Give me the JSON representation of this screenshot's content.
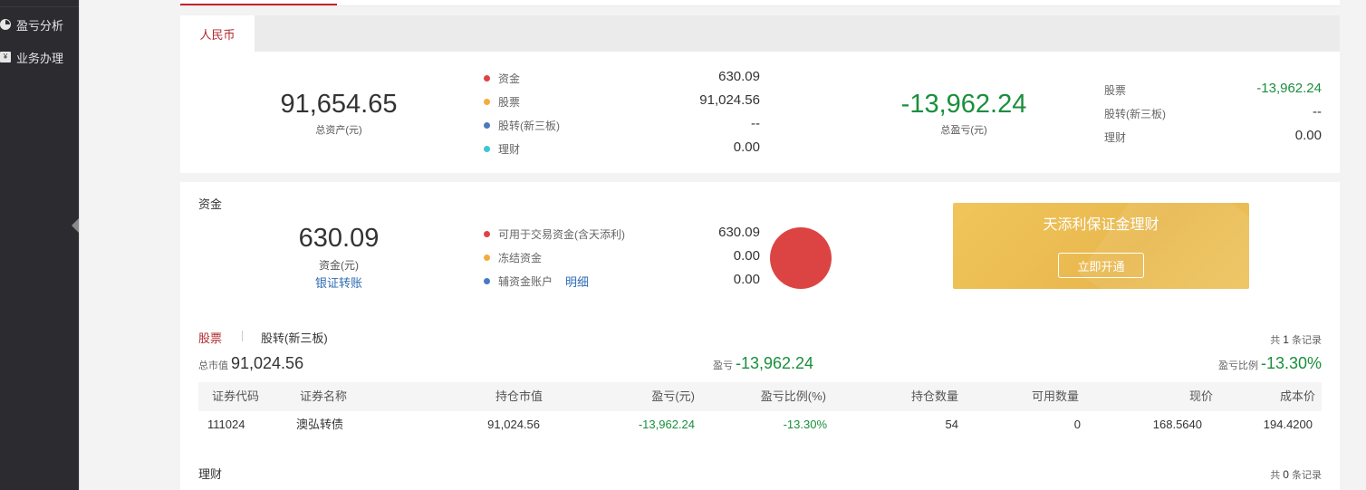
{
  "sidebar": {
    "items": [
      {
        "label": "盈亏分析",
        "icon": "pie-chart-icon"
      },
      {
        "label": "业务办理",
        "icon": "document-icon"
      }
    ]
  },
  "currency_tab": {
    "label": "人民币"
  },
  "summary": {
    "total_assets": {
      "value": "91,654.65",
      "label": "总资产(元)"
    },
    "breakdown": [
      {
        "label": "资金",
        "value": "630.09",
        "color": "#dc4443"
      },
      {
        "label": "股票",
        "value": "91,024.56",
        "color": "#f3ad3c"
      },
      {
        "label": "股转(新三板)",
        "value": "--",
        "color": "#4a78c2"
      },
      {
        "label": "理财",
        "value": "0.00",
        "color": "#3cc6d3"
      }
    ],
    "total_pl": {
      "value": "-13,962.24",
      "label": "总盈亏(元)"
    },
    "pl_breakdown": [
      {
        "label": "股票",
        "value": "-13,962.24",
        "color": "#1a8f3c"
      },
      {
        "label": "股转(新三板)",
        "value": "--",
        "color": "#333333"
      },
      {
        "label": "理财",
        "value": "0.00",
        "color": "#333333"
      }
    ]
  },
  "funds": {
    "title": "资金",
    "amount": "630.09",
    "amount_label": "资金(元)",
    "transfer_link": "银证转账",
    "items": [
      {
        "label": "可用于交易资金(含天添利)",
        "value": "630.09",
        "color": "#dc4443"
      },
      {
        "label": "冻结资金",
        "value": "0.00",
        "color": "#f3ad3c"
      },
      {
        "label": "辅资金账户",
        "value": "0.00",
        "color": "#4a78c2",
        "link": "明细"
      }
    ],
    "pie_color": "#dc4443",
    "banner": {
      "title": "天添利保证金理财",
      "button": "立即开通"
    }
  },
  "stocks": {
    "tabs": [
      "股票",
      "股转(新三板)"
    ],
    "record_count": {
      "prefix": "共",
      "num": "1",
      "suffix": "条记录"
    },
    "market_value_label": "总市值",
    "market_value": "91,024.56",
    "pl_label": "盈亏",
    "pl_value": "-13,962.24",
    "pl_ratio_label": "盈亏比例",
    "pl_ratio_value": "-13.30%",
    "columns": [
      "证券代码",
      "证券名称",
      "持仓市值",
      "盈亏(元)",
      "盈亏比例(%)",
      "持仓数量",
      "可用数量",
      "现价",
      "成本价"
    ],
    "rows": [
      {
        "code": "111024",
        "name": "澳弘转债",
        "market_value": "91,024.56",
        "pl": "-13,962.24",
        "pl_ratio": "-13.30%",
        "qty": "54",
        "avail": "0",
        "price": "168.5640",
        "cost": "194.4200"
      }
    ]
  },
  "wealth": {
    "title": "理财",
    "record_count": {
      "prefix": "共",
      "num": "0",
      "suffix": "条记录"
    }
  }
}
